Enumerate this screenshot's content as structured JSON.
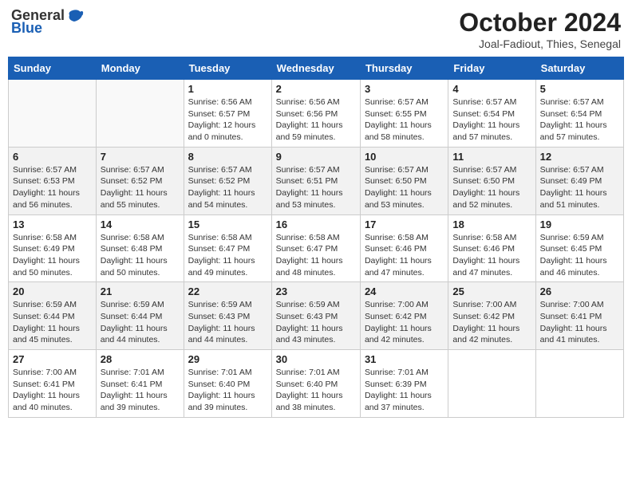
{
  "header": {
    "logo_general": "General",
    "logo_blue": "Blue",
    "title": "October 2024",
    "location": "Joal-Fadiout, Thies, Senegal"
  },
  "weekdays": [
    "Sunday",
    "Monday",
    "Tuesday",
    "Wednesday",
    "Thursday",
    "Friday",
    "Saturday"
  ],
  "rows": [
    [
      {
        "day": "",
        "info": ""
      },
      {
        "day": "",
        "info": ""
      },
      {
        "day": "1",
        "info": "Sunrise: 6:56 AM\nSunset: 6:57 PM\nDaylight: 12 hours\nand 0 minutes."
      },
      {
        "day": "2",
        "info": "Sunrise: 6:56 AM\nSunset: 6:56 PM\nDaylight: 11 hours\nand 59 minutes."
      },
      {
        "day": "3",
        "info": "Sunrise: 6:57 AM\nSunset: 6:55 PM\nDaylight: 11 hours\nand 58 minutes."
      },
      {
        "day": "4",
        "info": "Sunrise: 6:57 AM\nSunset: 6:54 PM\nDaylight: 11 hours\nand 57 minutes."
      },
      {
        "day": "5",
        "info": "Sunrise: 6:57 AM\nSunset: 6:54 PM\nDaylight: 11 hours\nand 57 minutes."
      }
    ],
    [
      {
        "day": "6",
        "info": "Sunrise: 6:57 AM\nSunset: 6:53 PM\nDaylight: 11 hours\nand 56 minutes."
      },
      {
        "day": "7",
        "info": "Sunrise: 6:57 AM\nSunset: 6:52 PM\nDaylight: 11 hours\nand 55 minutes."
      },
      {
        "day": "8",
        "info": "Sunrise: 6:57 AM\nSunset: 6:52 PM\nDaylight: 11 hours\nand 54 minutes."
      },
      {
        "day": "9",
        "info": "Sunrise: 6:57 AM\nSunset: 6:51 PM\nDaylight: 11 hours\nand 53 minutes."
      },
      {
        "day": "10",
        "info": "Sunrise: 6:57 AM\nSunset: 6:50 PM\nDaylight: 11 hours\nand 53 minutes."
      },
      {
        "day": "11",
        "info": "Sunrise: 6:57 AM\nSunset: 6:50 PM\nDaylight: 11 hours\nand 52 minutes."
      },
      {
        "day": "12",
        "info": "Sunrise: 6:57 AM\nSunset: 6:49 PM\nDaylight: 11 hours\nand 51 minutes."
      }
    ],
    [
      {
        "day": "13",
        "info": "Sunrise: 6:58 AM\nSunset: 6:49 PM\nDaylight: 11 hours\nand 50 minutes."
      },
      {
        "day": "14",
        "info": "Sunrise: 6:58 AM\nSunset: 6:48 PM\nDaylight: 11 hours\nand 50 minutes."
      },
      {
        "day": "15",
        "info": "Sunrise: 6:58 AM\nSunset: 6:47 PM\nDaylight: 11 hours\nand 49 minutes."
      },
      {
        "day": "16",
        "info": "Sunrise: 6:58 AM\nSunset: 6:47 PM\nDaylight: 11 hours\nand 48 minutes."
      },
      {
        "day": "17",
        "info": "Sunrise: 6:58 AM\nSunset: 6:46 PM\nDaylight: 11 hours\nand 47 minutes."
      },
      {
        "day": "18",
        "info": "Sunrise: 6:58 AM\nSunset: 6:46 PM\nDaylight: 11 hours\nand 47 minutes."
      },
      {
        "day": "19",
        "info": "Sunrise: 6:59 AM\nSunset: 6:45 PM\nDaylight: 11 hours\nand 46 minutes."
      }
    ],
    [
      {
        "day": "20",
        "info": "Sunrise: 6:59 AM\nSunset: 6:44 PM\nDaylight: 11 hours\nand 45 minutes."
      },
      {
        "day": "21",
        "info": "Sunrise: 6:59 AM\nSunset: 6:44 PM\nDaylight: 11 hours\nand 44 minutes."
      },
      {
        "day": "22",
        "info": "Sunrise: 6:59 AM\nSunset: 6:43 PM\nDaylight: 11 hours\nand 44 minutes."
      },
      {
        "day": "23",
        "info": "Sunrise: 6:59 AM\nSunset: 6:43 PM\nDaylight: 11 hours\nand 43 minutes."
      },
      {
        "day": "24",
        "info": "Sunrise: 7:00 AM\nSunset: 6:42 PM\nDaylight: 11 hours\nand 42 minutes."
      },
      {
        "day": "25",
        "info": "Sunrise: 7:00 AM\nSunset: 6:42 PM\nDaylight: 11 hours\nand 42 minutes."
      },
      {
        "day": "26",
        "info": "Sunrise: 7:00 AM\nSunset: 6:41 PM\nDaylight: 11 hours\nand 41 minutes."
      }
    ],
    [
      {
        "day": "27",
        "info": "Sunrise: 7:00 AM\nSunset: 6:41 PM\nDaylight: 11 hours\nand 40 minutes."
      },
      {
        "day": "28",
        "info": "Sunrise: 7:01 AM\nSunset: 6:41 PM\nDaylight: 11 hours\nand 39 minutes."
      },
      {
        "day": "29",
        "info": "Sunrise: 7:01 AM\nSunset: 6:40 PM\nDaylight: 11 hours\nand 39 minutes."
      },
      {
        "day": "30",
        "info": "Sunrise: 7:01 AM\nSunset: 6:40 PM\nDaylight: 11 hours\nand 38 minutes."
      },
      {
        "day": "31",
        "info": "Sunrise: 7:01 AM\nSunset: 6:39 PM\nDaylight: 11 hours\nand 37 minutes."
      },
      {
        "day": "",
        "info": ""
      },
      {
        "day": "",
        "info": ""
      }
    ]
  ]
}
